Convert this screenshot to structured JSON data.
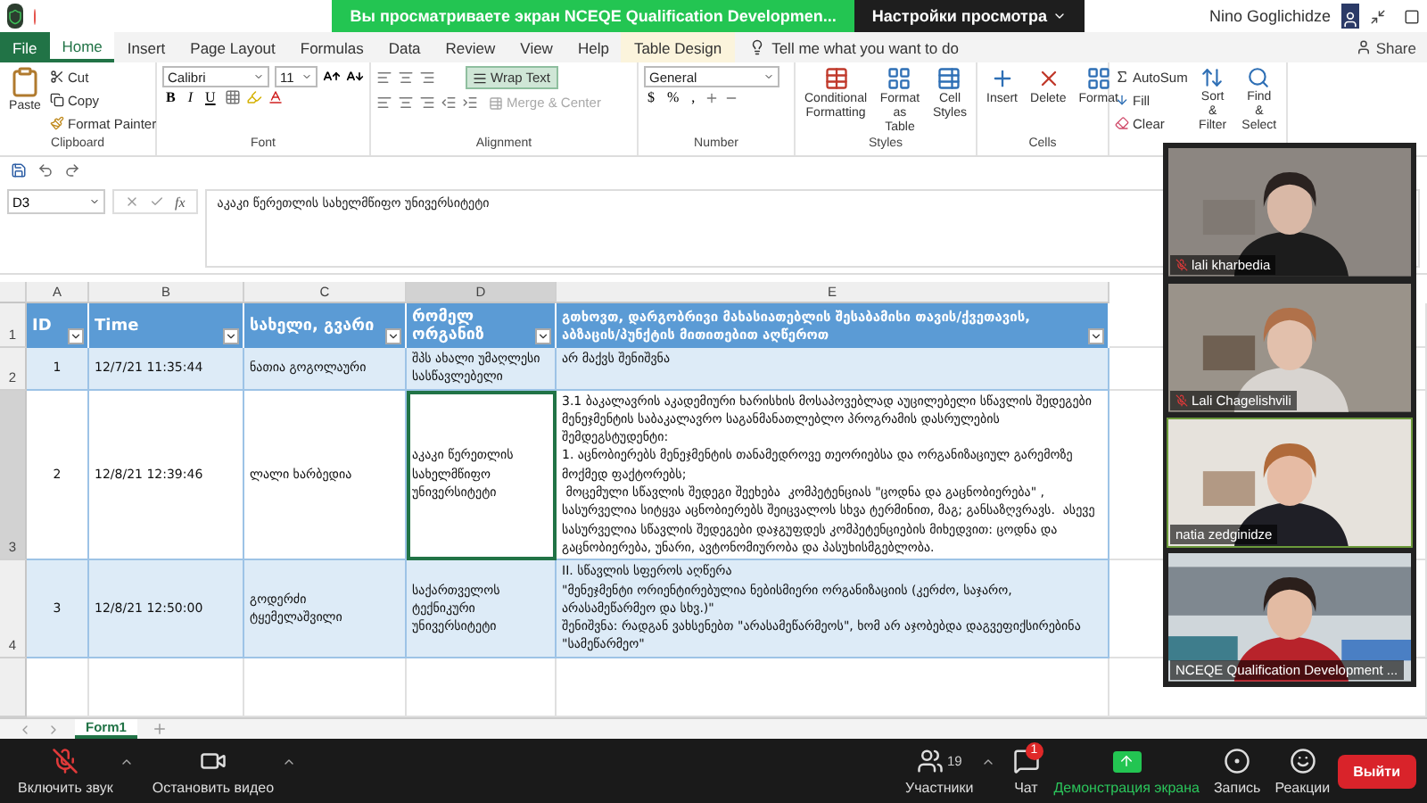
{
  "meeting_bar": {
    "banner": "Вы просматриваете экран NCEQE Qualification Developmen...",
    "view_options": "Настройки просмотра",
    "user": "Nino Goglichidze"
  },
  "ribbon_tabs": [
    {
      "label": "File",
      "kind": "file",
      "selected": false
    },
    {
      "label": "Home",
      "kind": "tab",
      "selected": true
    },
    {
      "label": "Insert",
      "kind": "tab",
      "selected": false
    },
    {
      "label": "Page Layout",
      "kind": "tab",
      "selected": false
    },
    {
      "label": "Formulas",
      "kind": "tab",
      "selected": false
    },
    {
      "label": "Data",
      "kind": "tab",
      "selected": false
    },
    {
      "label": "Review",
      "kind": "tab",
      "selected": false
    },
    {
      "label": "View",
      "kind": "tab",
      "selected": false
    },
    {
      "label": "Help",
      "kind": "tab",
      "selected": false
    },
    {
      "label": "Table Design",
      "kind": "contextual",
      "selected": false
    }
  ],
  "tell_me": "Tell me what you want to do",
  "share": "Share",
  "clipboard": {
    "paste": "Paste",
    "cut": "Cut",
    "copy": "Copy",
    "format_painter": "Format Painter",
    "label": "Clipboard"
  },
  "font": {
    "name": "Calibri",
    "size": "11",
    "styles": [
      "B",
      "I",
      "U"
    ],
    "label": "Font"
  },
  "alignment": {
    "wrap_text": {
      "label": "Wrap Text",
      "on": true
    },
    "merge": {
      "label": "Merge & Center",
      "disabled": true
    },
    "label": "Alignment"
  },
  "number": {
    "format": "General",
    "symbols": [
      "$",
      "%",
      ","
    ],
    "label": "Number"
  },
  "styles": {
    "buttons": [
      "Conditional Formatting",
      "Format as Table",
      "Cell Styles"
    ],
    "label": "Styles"
  },
  "cells": {
    "buttons": [
      "Insert",
      "Delete",
      "Format"
    ],
    "label": "Cells"
  },
  "editing": {
    "autosum": "AutoSum",
    "fill": "Fill",
    "clear": "Clear",
    "buttons": [
      "Sort & Filter",
      "Find & Select"
    ]
  },
  "formula_bar": {
    "name_box": "D3",
    "fx": "fx",
    "formula": "აკაკი წერეთლის სახელმწიფო უნივერსიტეტი"
  },
  "columns": [
    {
      "label": "A",
      "selected": false
    },
    {
      "label": "B",
      "selected": false
    },
    {
      "label": "C",
      "selected": false
    },
    {
      "label": "D",
      "selected": true
    },
    {
      "label": "E",
      "selected": false
    }
  ],
  "header_row": {
    "row_number": "1",
    "cells": [
      "ID",
      "Time",
      "სახელი, გვარი",
      "რომელ ორგანიზ",
      "გთხოვთ, დარგობრივი მახასიათებლის შესაბამისი თავის/ქვეთავის, აბზაცის/პუნქტის მითითებით აღწეროთ"
    ]
  },
  "rows": [
    {
      "row_number": "2",
      "selected": false,
      "cells": [
        {
          "text": "1",
          "selected": false
        },
        {
          "text": "12/7/21 11:35:44",
          "selected": false
        },
        {
          "text": "ნათია გოგოლაური",
          "selected": false
        },
        {
          "text": "შპს ახალი უმაღლესი სასწავლებელი",
          "selected": false
        },
        {
          "text": "არ მაქვს შენიშვნა",
          "selected": false
        }
      ]
    },
    {
      "row_number": "3",
      "selected": true,
      "cells": [
        {
          "text": "2",
          "selected": false
        },
        {
          "text": "12/8/21 12:39:46",
          "selected": false
        },
        {
          "text": "ლალი ხარბედია",
          "selected": false
        },
        {
          "text": "აკაკი წერეთლის სახელმწიფო უნივერსიტეტი",
          "selected": true
        },
        {
          "text": "3.1 ბაკალავრის აკადემიური ხარისხის მოსაპოვებლად აუცილებელი სწავლის შედეგები\nმენეჯმენტის საბაკალავრო საგანმანათლებლო პროგრამის დასრულების შემდეგსტუდენტი:\n1. აცნობიერებს მენეჯმენტის თანამედროვე თეორიებსა და ორგანიზაციულ გარემოზე მოქმედ ფაქტორებს;\n მოცემული სწავლის შედეგი შეეხება  კომპეტენციას \"ცოდნა და გაცნობიერება\" , სასურველია სიტყვა აცნობიერებს შეიცვალოს სხვა ტერმინით, მაგ; განსაზღვრავს.  ასევე  სასურველია სწავლის შედეგები დაჯგუფდეს კომპეტენციების მიხედვით: ცოდნა და გაცნობიერება, უნარი, ავტონომიურობა და პასუხისმგებლობა.",
          "selected": false
        }
      ]
    },
    {
      "row_number": "4",
      "selected": false,
      "cells": [
        {
          "text": "3",
          "selected": false
        },
        {
          "text": "12/8/21 12:50:00",
          "selected": false
        },
        {
          "text": "გოდერძი ტყემელაშვილი",
          "selected": false
        },
        {
          "text": "საქართველოს ტექნიკური უნივერსიტეტი",
          "selected": false
        },
        {
          "text": "II. სწავლის სფეროს აღწერა\n\"მენეჯმენტი ორიენტირებულია ნებისმიერი ორგანიზაციის (კერძო, საჯარო, არასამეწარმეო და სხვ.)\"\nშენიშვნა: რადგან ვახსენებთ \"არასამეწარმეოს\", ხომ არ აჯობებდა დაგვეფიქსირებინა \"სამეწარმეო\"",
          "selected": false
        }
      ]
    }
  ],
  "sheet_tabs": [
    {
      "label": "Form1",
      "selected": true
    }
  ],
  "videos": [
    {
      "name": "lali  kharbedia",
      "muted": true,
      "speaking": false,
      "kind": "picture"
    },
    {
      "name": "Lali Chagelishvili",
      "muted": true,
      "speaking": false,
      "kind": "picture"
    },
    {
      "name": "natia zedginidze",
      "muted": false,
      "speaking": true,
      "kind": "picture"
    },
    {
      "name": "NCEQE Qualification Development ...",
      "muted": false,
      "speaking": false,
      "kind": "picture"
    }
  ],
  "controls": [
    {
      "label": "Включить звук",
      "kind": "mic",
      "muted": true
    },
    {
      "label": "Остановить видео",
      "kind": "video"
    },
    {
      "label": "Участники",
      "kind": "participants",
      "count": "19"
    },
    {
      "label": "Чат",
      "kind": "chat",
      "badge": "1"
    },
    {
      "label": "Демонстрация экрана",
      "kind": "share",
      "on": true
    },
    {
      "label": "Запись",
      "kind": "record"
    },
    {
      "label": "Реакции",
      "kind": "reactions"
    }
  ],
  "leave": "Выйти"
}
